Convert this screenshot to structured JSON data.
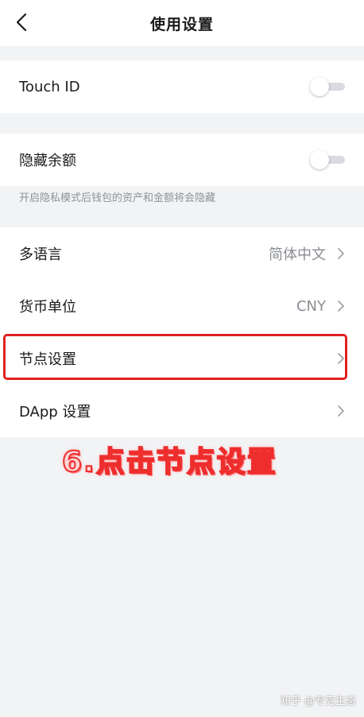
{
  "header": {
    "title": "使用设置",
    "back_icon": "chevron-left-icon"
  },
  "touch_id": {
    "label": "Touch ID",
    "enabled": false
  },
  "hide_balance": {
    "label": "隐藏余额",
    "enabled": false,
    "note": "开启隐私模式后钱包的资产和金额将会隐藏"
  },
  "language": {
    "label": "多语言",
    "value": "简体中文"
  },
  "currency": {
    "label": "货币单位",
    "value": "CNY"
  },
  "node": {
    "label": "节点设置"
  },
  "dapp": {
    "label": "DApp 设置"
  },
  "annotation": {
    "text": "6.点击节点设置",
    "color": "#ee2d2d"
  },
  "watermark": {
    "text": "知乎 @专克生态"
  },
  "colors": {
    "background": "#f2f3f5",
    "highlight": "#e02020",
    "secondary_text": "#8a8d93"
  }
}
